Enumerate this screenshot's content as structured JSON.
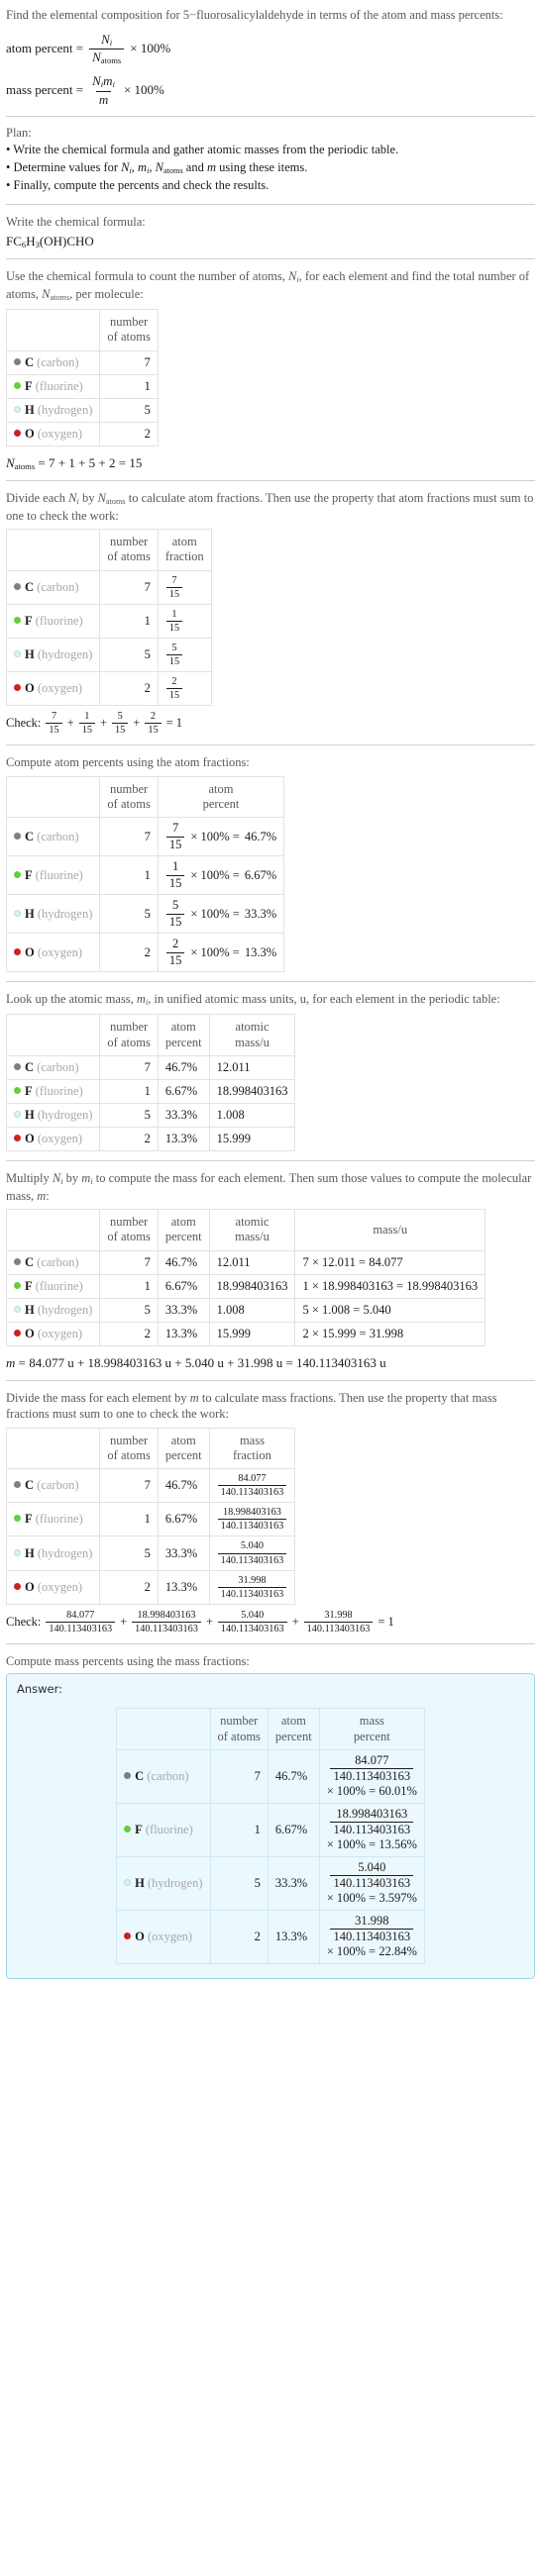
{
  "header": {
    "question": "Find the elemental composition for 5−fluorosalicylaldehyde in terms of the atom and mass percents:",
    "atom_percent_label": "atom percent =",
    "mass_percent_label": "mass percent =",
    "atom_percent_num": "N",
    "atom_percent_num_sub": "i",
    "atom_percent_den": "N",
    "atom_percent_den_sub": "atoms",
    "mass_percent_num": "N",
    "mass_percent_num_sub": "i",
    "mass_percent_num2": "m",
    "mass_percent_num2_sub": "i",
    "mass_percent_den": "m",
    "times100": "× 100%"
  },
  "plan": {
    "label": "Plan:",
    "bullets": [
      "• Write the chemical formula and gather atomic masses from the periodic table.",
      "• Determine values for Ni, mi, Natoms and m using these items.",
      "• Finally, compute the percents and check the results."
    ]
  },
  "formula_step": {
    "prompt": "Write the chemical formula:",
    "formula_parts": [
      "FC",
      "6",
      "H",
      "3",
      "(OH)CHO"
    ],
    "formula_plain": "FC6H3(OH)CHO"
  },
  "count_step": {
    "prompt": "Use the chemical formula to count the number of atoms, Ni, for each element and find the total number of atoms, Natoms, per molecule:",
    "headers": [
      "",
      "number of atoms"
    ],
    "natoms_line": "Natoms = 7 + 1 + 5 + 2 = 15",
    "natoms_symbol": "N",
    "natoms_sub": "atoms",
    "natoms_expr": "= 7 + 1 + 5 + 2 = 15"
  },
  "fraction_step": {
    "prompt": "Divide each Ni by Natoms to calculate atom fractions. Then use the property that atom fractions must sum to one to check the work:",
    "headers": [
      "",
      "number of atoms",
      "atom fraction"
    ],
    "check_label": "Check:",
    "check_result": "= 1"
  },
  "atom_percent_step": {
    "prompt": "Compute atom percents using the atom fractions:",
    "headers": [
      "",
      "number of atoms",
      "atom percent"
    ],
    "times100": "× 100% ="
  },
  "atomic_mass_step": {
    "prompt": "Look up the atomic mass, mi, in unified atomic mass units, u, for each element in the periodic table:",
    "headers": [
      "",
      "number of atoms",
      "atom percent",
      "atomic mass/u"
    ]
  },
  "mass_step": {
    "prompt": "Multiply Ni by mi to compute the mass for each element. Then sum those values to compute the molecular mass, m:",
    "headers": [
      "",
      "number of atoms",
      "atom percent",
      "atomic mass/u",
      "mass/u"
    ],
    "total_line": "m = 84.077 u + 18.998403163 u + 5.040 u + 31.998 u = 140.113403163 u",
    "total_symbol": "m",
    "total_expr": "= 84.077 u + 18.998403163 u + 5.040 u + 31.998 u = 140.113403163 u"
  },
  "mass_fraction_step": {
    "prompt": "Divide the mass for each element by m to calculate mass fractions. Then use the property that mass fractions must sum to one to check the work:",
    "headers": [
      "",
      "number of atoms",
      "atom percent",
      "mass fraction"
    ],
    "check_label": "Check:",
    "check_result": "= 1"
  },
  "mass_percent_step": {
    "prompt": "Compute mass percents using the mass fractions:",
    "answer_label": "Answer:",
    "headers": [
      "",
      "number of atoms",
      "atom percent",
      "mass percent"
    ],
    "times100": "× 100% ="
  },
  "total_atoms": "15",
  "molecular_mass": "140.113403163",
  "elements": [
    {
      "symbol": "C",
      "name": "(carbon)",
      "color": "#7f7f7f",
      "filled": true,
      "count": "7",
      "atom_fraction_num": "7",
      "atom_fraction_den": "15",
      "atom_percent": "46.7%",
      "atomic_mass": "12.011",
      "mass_expr": "7 × 12.011 = 84.077",
      "mass": "84.077",
      "mass_percent": "60.01%"
    },
    {
      "symbol": "F",
      "name": "(fluorine)",
      "color": "#66cc44",
      "filled": true,
      "count": "1",
      "atom_fraction_num": "1",
      "atom_fraction_den": "15",
      "atom_percent": "6.67%",
      "atomic_mass": "18.998403163",
      "mass_expr": "1 × 18.998403163 = 18.998403163",
      "mass": "18.998403163",
      "mass_percent": "13.56%"
    },
    {
      "symbol": "H",
      "name": "(hydrogen)",
      "color": "#d9f2f2",
      "filled": false,
      "count": "5",
      "atom_fraction_num": "5",
      "atom_fraction_den": "15",
      "atom_percent": "33.3%",
      "atomic_mass": "1.008",
      "mass_expr": "5 × 1.008 = 5.040",
      "mass": "5.040",
      "mass_percent": "3.597%"
    },
    {
      "symbol": "O",
      "name": "(oxygen)",
      "color": "#cc2222",
      "filled": true,
      "count": "2",
      "atom_fraction_num": "2",
      "atom_fraction_den": "15",
      "atom_percent": "13.3%",
      "atomic_mass": "15.999",
      "mass_expr": "2 × 15.999 = 31.998",
      "mass": "31.998",
      "mass_percent": "22.84%"
    }
  ]
}
